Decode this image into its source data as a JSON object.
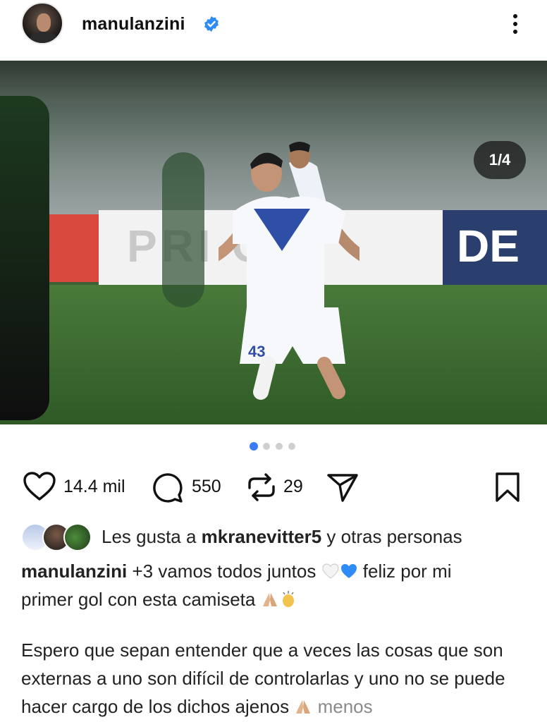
{
  "header": {
    "username": "manulanzini",
    "verified_icon": "verified-badge-icon",
    "more_icon": "more-vertical-icon"
  },
  "post": {
    "image_counter": "1/4",
    "carousel_total": 4,
    "carousel_active": 1
  },
  "actions": {
    "likes_count": "14.4 mil",
    "comments_count": "550",
    "reposts_count": "29"
  },
  "likes": {
    "prefix": "Les gusta a ",
    "user": "mkranevitter5",
    "suffix": " y otras personas"
  },
  "caption": {
    "username": "manulanzini",
    "line1_text": " +3 vamos todos juntos ",
    "line1_after": " feliz por mi",
    "line2_text": "primer gol con esta camiseta ",
    "paragraph2": "Espero que sepan entender que a veces las cosas que son externas a uno son difícil de controlarlas y uno no se puede hacer cargo de los dichos ajenos ",
    "more_label": "menos"
  },
  "colors": {
    "accent": "#3b7bf6",
    "verified": "#2f8cf7"
  }
}
